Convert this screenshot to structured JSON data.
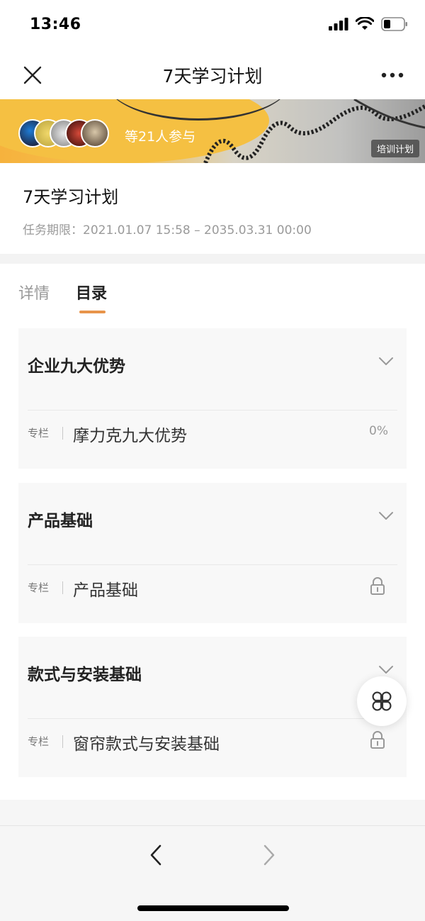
{
  "status_bar": {
    "time": "13:46"
  },
  "nav": {
    "title": "7天学习计划",
    "close_icon": "close-icon",
    "more_icon": "more-icon"
  },
  "banner": {
    "participants_text": "等21人参与",
    "tag": "培训计划"
  },
  "plan": {
    "title": "7天学习计划",
    "period": "任务期限：2021.01.07 15:58 – 2035.03.31 00:00"
  },
  "tabs": [
    {
      "label": "详情",
      "active": false
    },
    {
      "label": "目录",
      "active": true
    }
  ],
  "sections": [
    {
      "title": "企业九大优势",
      "row": {
        "tag": "专栏",
        "name": "摩力克九大优势",
        "progress": "0%",
        "locked": false
      }
    },
    {
      "title": "产品基础",
      "row": {
        "tag": "专栏",
        "name": "产品基础",
        "locked": true
      }
    },
    {
      "title": "款式与安装基础",
      "row": {
        "tag": "专栏",
        "name": "窗帘款式与安装基础",
        "locked": true
      }
    }
  ],
  "colors": {
    "accent": "#e8944a",
    "card_bg": "#f8f8f8"
  }
}
